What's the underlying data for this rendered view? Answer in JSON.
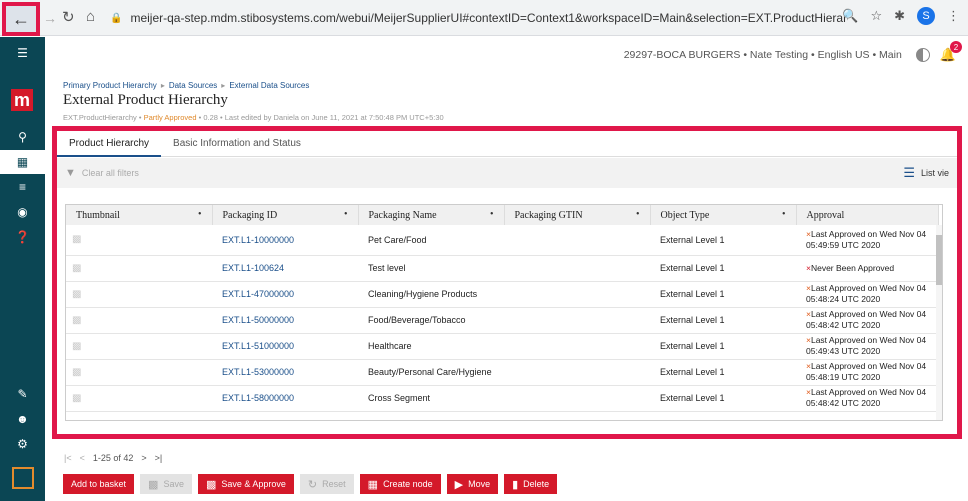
{
  "browser": {
    "url": "meijer-qa-step.mdm.stibosystems.com/webui/MeijerSupplierUI#contextID=Context1&workspaceID=Main&selection=EXT.ProductHierarchy&nodeType=product...",
    "profile_initial": "S"
  },
  "header": {
    "context": "29297-BOCA BURGERS • Nate Testing • English US • Main",
    "notification_count": "2"
  },
  "breadcrumb": [
    "Primary Product Hierarchy",
    "Data Sources",
    "External Data Sources"
  ],
  "page": {
    "title": "External Product Hierarchy",
    "meta_id": "EXT.ProductHierarchy",
    "meta_status": "Partly Approved",
    "meta_rest": "• 0.28 • Last edited by Daniela on June 11, 2021 at 7:50:48 PM UTC+5:30"
  },
  "tabs": [
    "Product Hierarchy",
    "Basic Information and Status"
  ],
  "toolbar": {
    "clear_filters": "Clear all filters",
    "list_view": "List vie"
  },
  "table": {
    "columns": [
      "Thumbnail",
      "Packaging ID",
      "Packaging Name",
      "Packaging GTIN",
      "Object Type",
      "Approval"
    ],
    "rows": [
      {
        "id": "EXT.L1-10000000",
        "name": "Pet Care/Food",
        "gtin": "",
        "type": "External Level 1",
        "approval": "Last Approved on Wed Nov 04 05:49:59 UTC 2020"
      },
      {
        "id": "EXT.L1-100624",
        "name": "Test level",
        "gtin": "",
        "type": "External Level 1",
        "approval": "Never Been Approved"
      },
      {
        "id": "EXT.L1-47000000",
        "name": "Cleaning/Hygiene Products",
        "gtin": "",
        "type": "External Level 1",
        "approval": "Last Approved on Wed Nov 04 05:48:24 UTC 2020"
      },
      {
        "id": "EXT.L1-50000000",
        "name": "Food/Beverage/Tobacco",
        "gtin": "",
        "type": "External Level 1",
        "approval": "Last Approved on Wed Nov 04 05:48:42 UTC 2020"
      },
      {
        "id": "EXT.L1-51000000",
        "name": "Healthcare",
        "gtin": "",
        "type": "External Level 1",
        "approval": "Last Approved on Wed Nov 04 05:49:43 UTC 2020"
      },
      {
        "id": "EXT.L1-53000000",
        "name": "Beauty/Personal Care/Hygiene",
        "gtin": "",
        "type": "External Level 1",
        "approval": "Last Approved on Wed Nov 04 05:48:19 UTC 2020"
      },
      {
        "id": "EXT.L1-58000000",
        "name": "Cross Segment",
        "gtin": "",
        "type": "External Level 1",
        "approval": "Last Approved on Wed Nov 04 05:48:42 UTC 2020"
      }
    ]
  },
  "pager": {
    "range": "1-25 of 42"
  },
  "actions": {
    "add_to_basket": "Add to basket",
    "save": "Save",
    "save_approve": "Save & Approve",
    "reset": "Reset",
    "create_node": "Create node",
    "move": "Move",
    "delete": "Delete"
  },
  "colors": {
    "accent": "#d4192a",
    "highlight": "#e0174a",
    "rail": "#0b4654",
    "link": "#1a4f8a"
  }
}
